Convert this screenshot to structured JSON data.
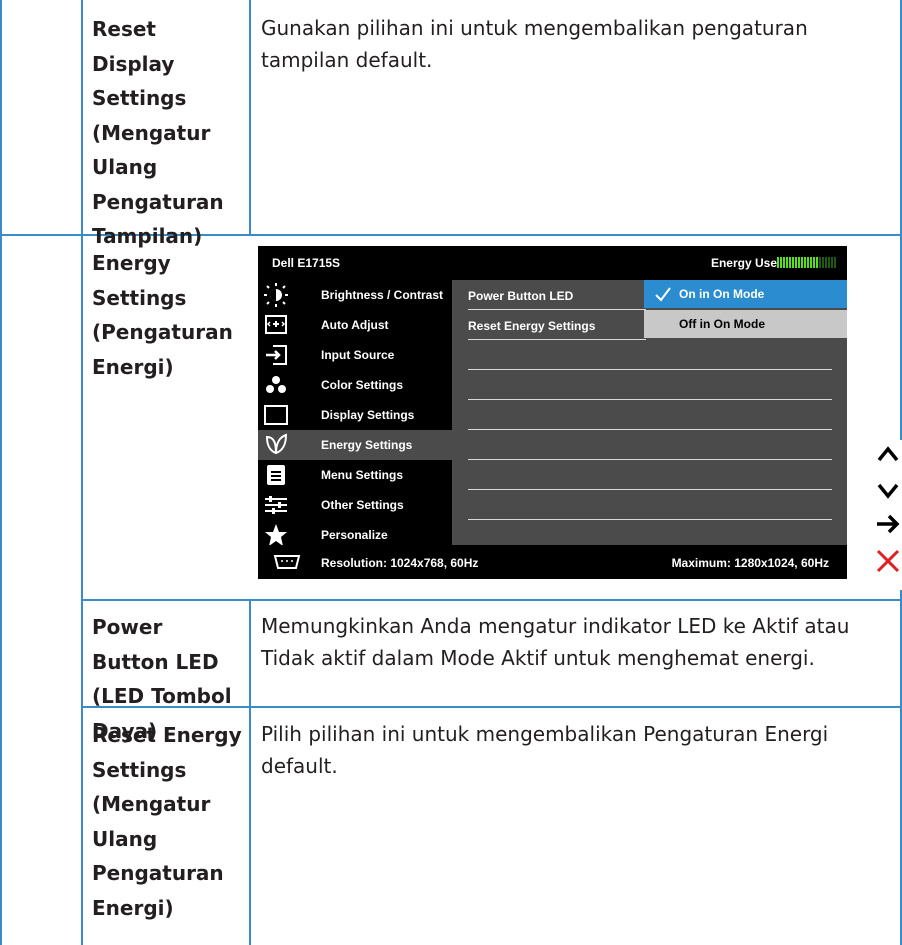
{
  "rows": [
    {
      "label": "Reset Display Settings (Mengatur Ulang Pengaturan Tampilan)",
      "label_lines": [
        "Reset",
        "Display",
        "Settings",
        "(Mengatur",
        "Ulang",
        "Pengaturan",
        "Tampilan)"
      ],
      "description": "Gunakan pilihan ini untuk mengembalikan pengaturan tampilan default."
    },
    {
      "label": "Energy Settings (Pengaturan Energi)",
      "label_lines": [
        "Energy",
        "Settings",
        "(Pengaturan",
        "Energi)"
      ],
      "description": ""
    },
    {
      "label": "Power Button LED (LED Tombol Daya)",
      "label_lines": [
        "Power",
        "Button LED",
        "(LED Tombol",
        "Daya)"
      ],
      "description": "Memungkinkan Anda mengatur indikator LED ke Aktif atau Tidak aktif dalam Mode Aktif untuk menghemat energi."
    },
    {
      "label": "Reset Energy Settings (Mengatur Ulang Pengaturan Energi)",
      "label_lines": [
        "Reset Energy",
        "Settings",
        "(Mengatur",
        "Ulang",
        "Pengaturan",
        "Energi)"
      ],
      "description": "Pilih pilihan ini untuk mengembalikan Pengaturan Energi default."
    }
  ],
  "osd": {
    "model": "Dell E1715S",
    "energy_use_label": "Energy Use",
    "energy_level_fraction": 0.72,
    "menu": [
      {
        "label": "Brightness / Contrast",
        "icon": "brightness-icon"
      },
      {
        "label": "Auto Adjust",
        "icon": "auto-adjust-icon"
      },
      {
        "label": "Input Source",
        "icon": "input-source-icon"
      },
      {
        "label": "Color Settings",
        "icon": "color-settings-icon"
      },
      {
        "label": "Display Settings",
        "icon": "display-settings-icon"
      },
      {
        "label": "Energy Settings",
        "icon": "energy-leaf-icon"
      },
      {
        "label": "Menu Settings",
        "icon": "menu-settings-icon"
      },
      {
        "label": "Other Settings",
        "icon": "other-settings-icon"
      },
      {
        "label": "Personalize",
        "icon": "star-icon"
      }
    ],
    "selected_menu": "Energy Settings",
    "submenu": [
      "Power Button LED",
      "Reset Energy Settings"
    ],
    "options": [
      "On in On Mode",
      "Off in On Mode"
    ],
    "selected_option": "On in On Mode",
    "resolution": "Resolution: 1024x768, 60Hz",
    "maximum": "Maximum: 1280x1024, 60Hz",
    "colors": {
      "accent": "#2b8ccf",
      "grid": "#3a8bc8",
      "energy_bar": "#58e01a",
      "close": "#e02020"
    }
  },
  "nav_icons": [
    "up-arrow-icon",
    "down-arrow-icon",
    "right-arrow-icon",
    "close-icon"
  ]
}
